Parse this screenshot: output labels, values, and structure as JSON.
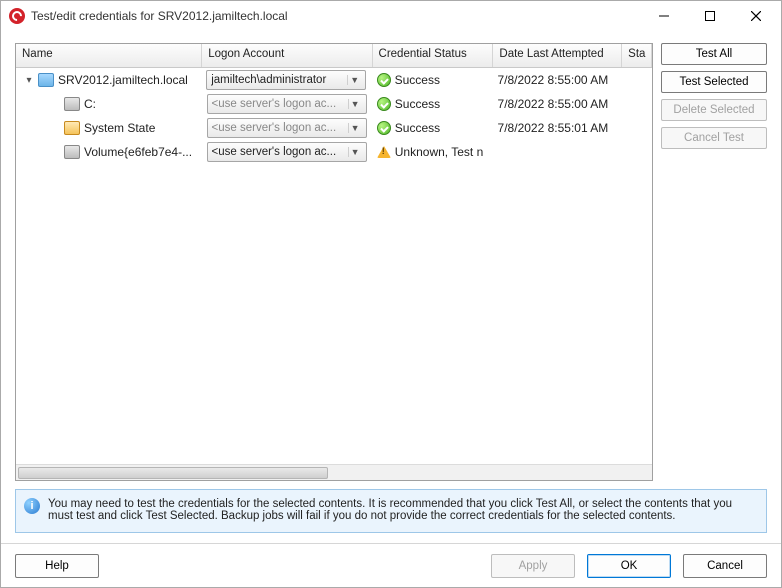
{
  "window": {
    "title": "Test/edit credentials for SRV2012.jamiltech.local"
  },
  "columns": {
    "name": "Name",
    "logon": "Logon Account",
    "status": "Credential Status",
    "date": "Date Last Attempted",
    "sta": "Sta"
  },
  "rows": [
    {
      "name": "SRV2012.jamiltech.local",
      "logon": "jamiltech\\administrator",
      "logon_muted": false,
      "status_icon": "ok",
      "status": "Success",
      "date": "7/8/2022 8:55:00 AM",
      "icon": "server",
      "indent": 1,
      "arrow": true
    },
    {
      "name": "C:",
      "logon": "<use server's logon ac...",
      "logon_muted": true,
      "status_icon": "ok",
      "status": "Success",
      "date": "7/8/2022 8:55:00 AM",
      "icon": "drive",
      "indent": 2,
      "arrow": false
    },
    {
      "name": "System State",
      "logon": "<use server's logon ac...",
      "logon_muted": true,
      "status_icon": "ok",
      "status": "Success",
      "date": "7/8/2022 8:55:01 AM",
      "icon": "sys",
      "indent": 2,
      "arrow": false
    },
    {
      "name": "Volume{e6feb7e4-...",
      "logon": "<use server's logon ac...",
      "logon_muted": false,
      "status_icon": "warn",
      "status": "Unknown, Test n",
      "date": "",
      "icon": "vol",
      "indent": 2,
      "arrow": false
    }
  ],
  "actions": {
    "test_all": "Test All",
    "test_selected": "Test Selected",
    "delete_selected": "Delete Selected",
    "cancel_test": "Cancel Test"
  },
  "info": {
    "text": "You may need to test the credentials for the selected contents. It is recommended that you click Test All, or select the contents that you must test and click Test Selected. Backup jobs will fail if you do not provide the correct credentials for the selected contents."
  },
  "bottom": {
    "help": "Help",
    "apply": "Apply",
    "ok": "OK",
    "cancel": "Cancel"
  }
}
